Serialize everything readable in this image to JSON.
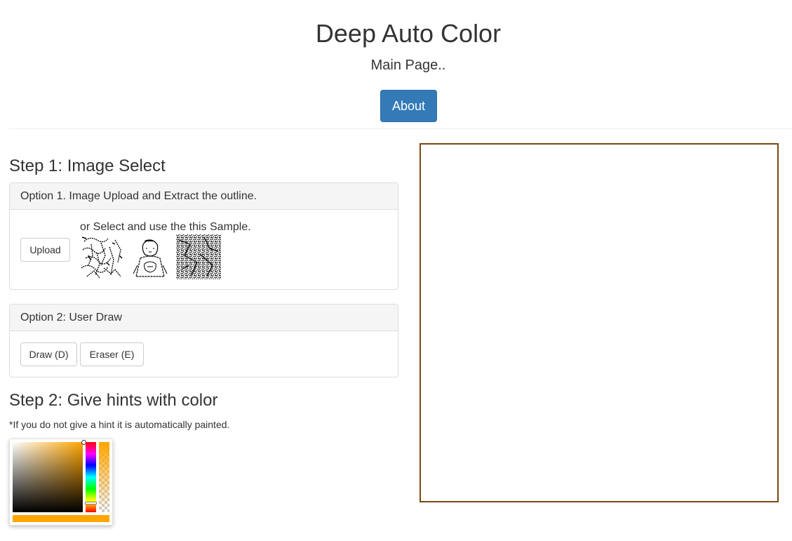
{
  "header": {
    "title": "Deep Auto Color",
    "subtitle": "Main Page..",
    "about_label": "About"
  },
  "step1": {
    "heading": "Step 1: Image Select",
    "option1": {
      "heading": "Option 1. Image Upload and Extract the outline.",
      "upload_label": "Upload",
      "sample_text": "or Select and use the this Sample."
    },
    "option2": {
      "heading": "Option 2: User Draw",
      "draw_label": "Draw (D)",
      "eraser_label": "Eraser (E)"
    }
  },
  "step2": {
    "heading": "Step 2: Give hints with color",
    "note": "*If you do not give a hint it is automatically painted."
  },
  "colors": {
    "primary": "#337ab7",
    "selected_color": "#ffa500",
    "canvas_border": "#7a4a10"
  },
  "icons": {
    "samples": [
      "sample-sketch-1",
      "sample-sketch-2",
      "sample-sketch-3"
    ]
  }
}
